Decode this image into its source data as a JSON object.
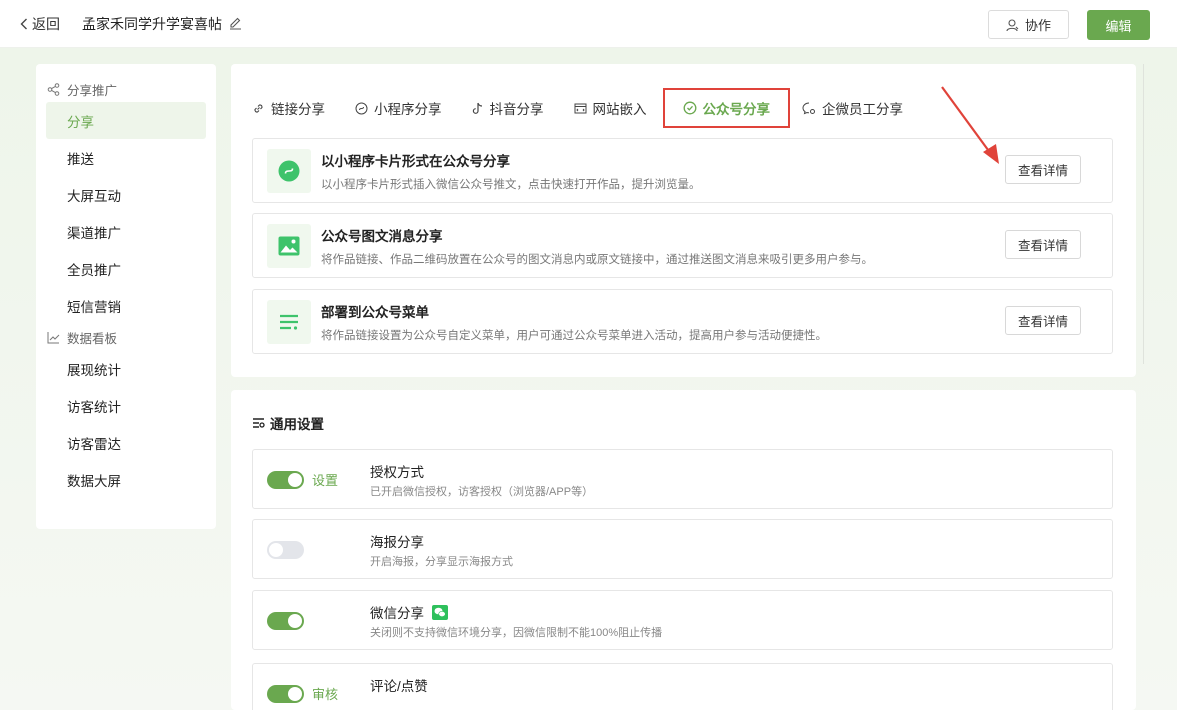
{
  "topbar": {
    "back_label": "返回",
    "doc_title": "孟家禾同学升学宴喜帖",
    "collab_label": "协作",
    "edit_label": "编辑"
  },
  "sidebar": {
    "share_section": "分享推广",
    "share_items": [
      "分享",
      "推送",
      "大屏互动",
      "渠道推广",
      "全员推广",
      "短信营销"
    ],
    "data_section": "数据看板",
    "data_items": [
      "展现统计",
      "访客统计",
      "访客雷达",
      "数据大屏"
    ],
    "active_item": "分享"
  },
  "tabs": [
    {
      "label": "链接分享",
      "icon": "link-icon"
    },
    {
      "label": "小程序分享",
      "icon": "mini-program-icon"
    },
    {
      "label": "抖音分享",
      "icon": "douyin-icon"
    },
    {
      "label": "网站嵌入",
      "icon": "website-icon"
    },
    {
      "label": "公众号分享",
      "icon": "official-account-icon",
      "active": true
    },
    {
      "label": "企微员工分享",
      "icon": "wecom-icon"
    }
  ],
  "options": [
    {
      "title": "以小程序卡片形式在公众号分享",
      "desc": "以小程序卡片形式插入微信公众号推文，点击快速打开作品，提升浏览量。",
      "button": "查看详情",
      "icon": "mini-program-card-icon"
    },
    {
      "title": "公众号图文消息分享",
      "desc": "将作品链接、作品二维码放置在公众号的图文消息内或原文链接中，通过推送图文消息来吸引更多用户参与。",
      "button": "查看详情",
      "icon": "image-message-icon"
    },
    {
      "title": "部署到公众号菜单",
      "desc": "将作品链接设置为公众号自定义菜单，用户可通过公众号菜单进入活动，提高用户参与活动便捷性。",
      "button": "查看详情",
      "icon": "menu-list-icon"
    }
  ],
  "general": {
    "heading": "通用设置",
    "settings": [
      {
        "title": "授权方式",
        "desc": "已开启微信授权，访客授权（浏览器/APP等）",
        "on": true,
        "toggle_label": "设置"
      },
      {
        "title": "海报分享",
        "desc": "开启海报，分享显示海报方式",
        "on": false,
        "toggle_label": ""
      },
      {
        "title": "微信分享",
        "desc": "关闭则不支持微信环境分享，因微信限制不能100%阻止传播",
        "on": true,
        "toggle_label": "",
        "badge_icon": "wechat-icon"
      },
      {
        "title": "评论/点赞",
        "desc": "",
        "on": true,
        "toggle_label": "审核"
      }
    ]
  },
  "colors": {
    "accent": "#6aa84f",
    "highlight_border": "#e0433a",
    "arrow": "#e0433a"
  }
}
